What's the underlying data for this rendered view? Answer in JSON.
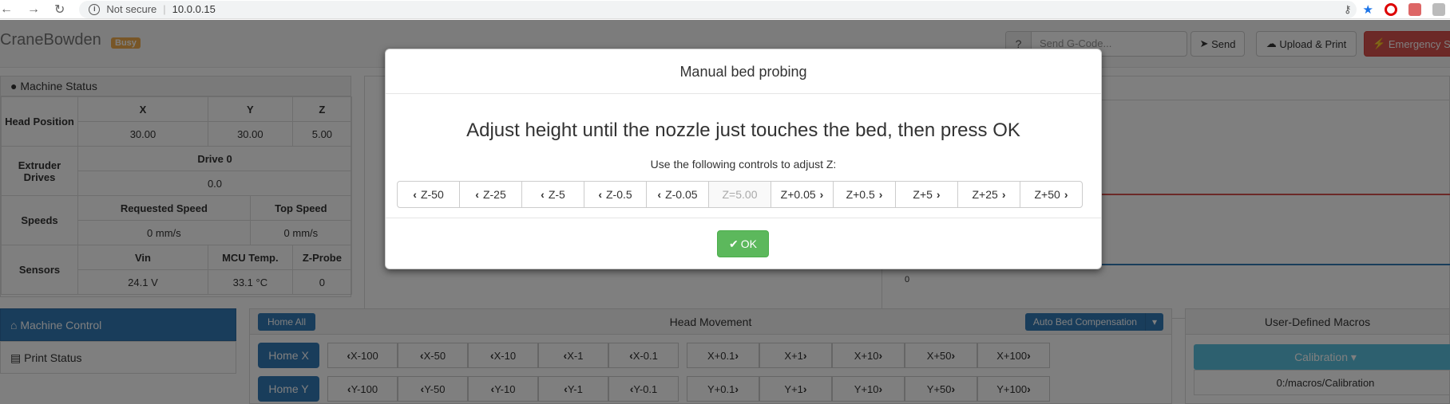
{
  "browser": {
    "security": "Not secure",
    "url": "10.0.0.15"
  },
  "navbar": {
    "brand": "CraneBowden",
    "status_badge": "Busy",
    "gcode_help": "?",
    "gcode_placeholder": "Send G-Code...",
    "send_label": "Send",
    "upload_label": "Upload & Print",
    "emergency_label": "Emergency S"
  },
  "machine_status": {
    "title": "Machine Status",
    "head_label": "Head Position",
    "axes": [
      "X",
      "Y",
      "Z"
    ],
    "positions": [
      "30.00",
      "30.00",
      "5.00"
    ],
    "extruder_label": "Extruder Drives",
    "drive_header": "Drive 0",
    "drive_value": "0.0",
    "speeds_label": "Speeds",
    "requested_speed_label": "Requested Speed",
    "top_speed_label": "Top Speed",
    "requested_speed": "0 mm/s",
    "top_speed": "0 mm/s",
    "sensors_label": "Sensors",
    "vin_label": "Vin",
    "mcu_label": "MCU Temp.",
    "zprobe_label": "Z-Probe",
    "vin": "24.1 V",
    "mcu": "33.1 °C",
    "zprobe": "0"
  },
  "graph": {
    "zero_label": "0"
  },
  "sidebar": {
    "items": [
      {
        "label": "Machine Control"
      },
      {
        "label": "Print Status"
      }
    ]
  },
  "movement": {
    "title": "Head Movement",
    "home_all": "Home All",
    "auto_bed": "Auto Bed Compensation",
    "home_x": "Home X",
    "home_y": "Home Y",
    "x_neg": [
      "X-100",
      "X-50",
      "X-10",
      "X-1",
      "X-0.1"
    ],
    "x_pos": [
      "X+0.1",
      "X+1",
      "X+10",
      "X+50",
      "X+100"
    ],
    "y_neg": [
      "Y-100",
      "Y-50",
      "Y-10",
      "Y-1",
      "Y-0.1"
    ],
    "y_pos": [
      "Y+0.1",
      "Y+1",
      "Y+10",
      "Y+50",
      "Y+100"
    ]
  },
  "macros": {
    "title": "User-Defined Macros",
    "calibration": "Calibration",
    "path": "0:/macros/Calibration"
  },
  "modal": {
    "title": "Manual bed probing",
    "message": "Adjust height until the nozzle just touches the bed, then press OK",
    "hint": "Use the following controls to adjust Z:",
    "z_buttons": [
      "Z-50",
      "Z-25",
      "Z-5",
      "Z-0.5",
      "Z-0.05",
      "Z=5.00",
      "Z+0.05",
      "Z+0.5",
      "Z+5",
      "Z+25",
      "Z+50"
    ],
    "ok_label": "OK"
  },
  "colors": {
    "primary": "#337ab7",
    "success": "#5cb85c",
    "danger": "#d9534f",
    "warning": "#f0ad4e",
    "info": "#5bc0de"
  }
}
